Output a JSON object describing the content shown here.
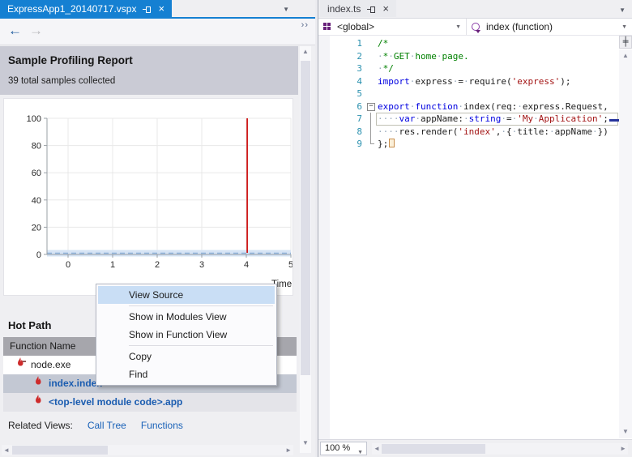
{
  "left_panel": {
    "tab": {
      "title": "ExpressApp1_20140717.vspx"
    },
    "report": {
      "title": "Sample Profiling Report",
      "subtitle": "39 total samples collected"
    },
    "hot_path": {
      "heading": "Hot Path",
      "table_header": "Function Name",
      "rows": [
        {
          "icon": "hot-path-root-flame-icon",
          "label": "node.exe",
          "indent": 0,
          "selected": false,
          "alt": false,
          "link": false
        },
        {
          "icon": "flame-icon",
          "label": "index.index",
          "indent": 1,
          "selected": true,
          "alt": false,
          "link": true
        },
        {
          "icon": "flame-icon",
          "label": "<top-level module code>.app",
          "indent": 1,
          "selected": false,
          "alt": true,
          "link": true
        }
      ]
    },
    "related_views": {
      "label": "Related Views:",
      "links": [
        "Call Tree",
        "Functions"
      ]
    }
  },
  "context_menu": {
    "items": [
      {
        "label": "View Source",
        "highlighted": true
      },
      {
        "separator": true
      },
      {
        "label": "Show in Modules View"
      },
      {
        "label": "Show in Function View"
      },
      {
        "separator": true
      },
      {
        "label": "Copy"
      },
      {
        "label": "Find"
      }
    ]
  },
  "chart_data": {
    "type": "line",
    "title": "",
    "xlabel": "Time",
    "ylabel": "",
    "x_ticks": [
      0,
      1,
      2,
      3,
      4,
      5
    ],
    "y_ticks": [
      0,
      20,
      40,
      60,
      80,
      100
    ],
    "xlim": [
      0,
      5.05
    ],
    "ylim": [
      0,
      100
    ],
    "grid": true,
    "legend": "none",
    "series": [
      {
        "name": "cpu-usage-baseline",
        "type": "band-line",
        "color": "#8FB3DC",
        "fill": "#D6E4F5",
        "x": [
          0,
          5.05
        ],
        "y": [
          0,
          0
        ]
      },
      {
        "name": "current-time-marker",
        "type": "vline",
        "color": "#CC0000",
        "x": 4.02,
        "y_from": 0,
        "y_to": 100
      }
    ]
  },
  "editor_panel": {
    "tab": {
      "title": "index.ts"
    },
    "nav": {
      "scope": "<global>",
      "member": "index (function)"
    },
    "zoom": "100 %",
    "code": {
      "lines": [
        {
          "n": "1",
          "fold": "",
          "cur": false,
          "segs": [
            [
              "cm",
              "/*"
            ]
          ]
        },
        {
          "n": "2",
          "fold": "",
          "cur": false,
          "segs": [
            [
              "ws",
              "·"
            ],
            [
              "cm",
              "*"
            ],
            [
              "ws",
              "·"
            ],
            [
              "cm",
              "GET"
            ],
            [
              "ws",
              "·"
            ],
            [
              "cm",
              "home"
            ],
            [
              "ws",
              "·"
            ],
            [
              "cm",
              "page."
            ]
          ]
        },
        {
          "n": "3",
          "fold": "",
          "cur": false,
          "segs": [
            [
              "ws",
              "·"
            ],
            [
              "cm",
              "*/"
            ]
          ]
        },
        {
          "n": "4",
          "fold": "",
          "cur": false,
          "segs": [
            [
              "kw",
              "import"
            ],
            [
              "ws",
              "·"
            ],
            [
              "pl",
              "express"
            ],
            [
              "ws",
              "·"
            ],
            [
              "pl",
              "="
            ],
            [
              "ws",
              "·"
            ],
            [
              "pl",
              "require("
            ],
            [
              "st",
              "'express'"
            ],
            [
              "pl",
              ");"
            ]
          ]
        },
        {
          "n": "5",
          "fold": "",
          "cur": false,
          "segs": []
        },
        {
          "n": "6",
          "fold": "minus",
          "cur": false,
          "segs": [
            [
              "kw",
              "export"
            ],
            [
              "ws",
              "·"
            ],
            [
              "kw",
              "function"
            ],
            [
              "ws",
              "·"
            ],
            [
              "pl",
              "index(req:"
            ],
            [
              "ws",
              "·"
            ],
            [
              "pl",
              "express.Request,"
            ]
          ]
        },
        {
          "n": "7",
          "fold": "bar",
          "cur": true,
          "segs": [
            [
              "ws",
              "····"
            ],
            [
              "kw",
              "var"
            ],
            [
              "ws",
              "·"
            ],
            [
              "pl",
              "appName:"
            ],
            [
              "ws",
              "·"
            ],
            [
              "kw",
              "string"
            ],
            [
              "ws",
              "·"
            ],
            [
              "pl",
              "="
            ],
            [
              "ws",
              "·"
            ],
            [
              "st",
              "'My"
            ],
            [
              "ws",
              "·"
            ],
            [
              "st",
              "Application'"
            ],
            [
              "pl",
              ";"
            ],
            [
              "cursor",
              ""
            ]
          ]
        },
        {
          "n": "8",
          "fold": "bar",
          "cur": false,
          "segs": [
            [
              "ws",
              "····"
            ],
            [
              "pl",
              "res.render("
            ],
            [
              "st",
              "'index'"
            ],
            [
              "pl",
              ","
            ],
            [
              "ws",
              "·"
            ],
            [
              "pl",
              "{"
            ],
            [
              "ws",
              "·"
            ],
            [
              "pl",
              "title:"
            ],
            [
              "ws",
              "·"
            ],
            [
              "pl",
              "appName"
            ],
            [
              "ws",
              "·"
            ],
            [
              "pl",
              "})"
            ]
          ]
        },
        {
          "n": "9",
          "fold": "end",
          "cur": false,
          "segs": [
            [
              "pl",
              "};"
            ],
            [
              "box",
              ""
            ]
          ]
        }
      ]
    }
  },
  "icons": {
    "close": "×",
    "dropdown_arrow": "▼",
    "combo_arrow": "▼",
    "scroll_up": "▲",
    "scroll_down": "▼",
    "scroll_left": "◄",
    "scroll_right": "►",
    "back_arrow": "←",
    "forward_arrow": "→",
    "overflow": "››",
    "fold_collapse": "−",
    "splitter": "╪"
  },
  "colors": {
    "tab_active": "#1580D2",
    "menu_highlight": "#C9DEF5",
    "flame_red": "#CE2B2B",
    "link_blue": "#1A5CB0",
    "keyword_blue": "#0000E0",
    "string_red": "#A31515",
    "comment_green": "#008000",
    "line_number_teal": "#2B91AF",
    "marker_red": "#CC0000",
    "grid_gray": "#E8E8E8"
  }
}
